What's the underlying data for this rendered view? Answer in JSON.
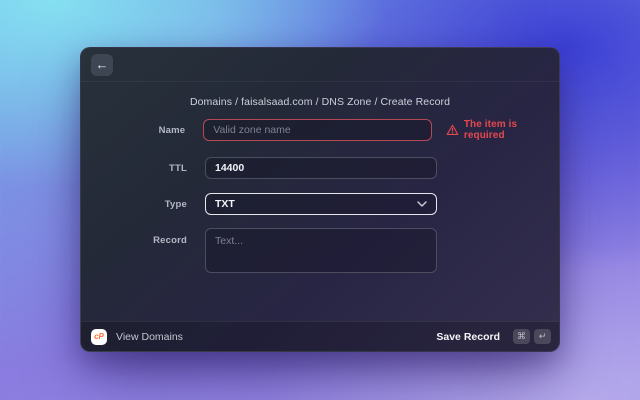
{
  "header": {
    "back_icon": "←"
  },
  "breadcrumb": "Domains / faisalsaad.com / DNS Zone / Create Record",
  "form": {
    "name": {
      "label": "Name",
      "value": "",
      "placeholder": "Valid zone name",
      "error": "The item is required"
    },
    "ttl": {
      "label": "TTL",
      "value": "14400"
    },
    "type": {
      "label": "Type",
      "value": "TXT"
    },
    "record": {
      "label": "Record",
      "value": "",
      "placeholder": "Text..."
    }
  },
  "footer": {
    "logo_text": "cP",
    "view_domains_label": "View Domains",
    "save_label": "Save Record",
    "shortcut_keys": [
      "⌘",
      "↵"
    ]
  },
  "colors": {
    "error_text": "#e5484d",
    "error_border": "#b54855",
    "focus_border": "#e7e8ee",
    "cpanel_orange": "#ff6c2c",
    "bg_cyan": "#85e0f1",
    "bg_indigo": "#3c40d5",
    "bg_purple": "#8a7ce0"
  }
}
